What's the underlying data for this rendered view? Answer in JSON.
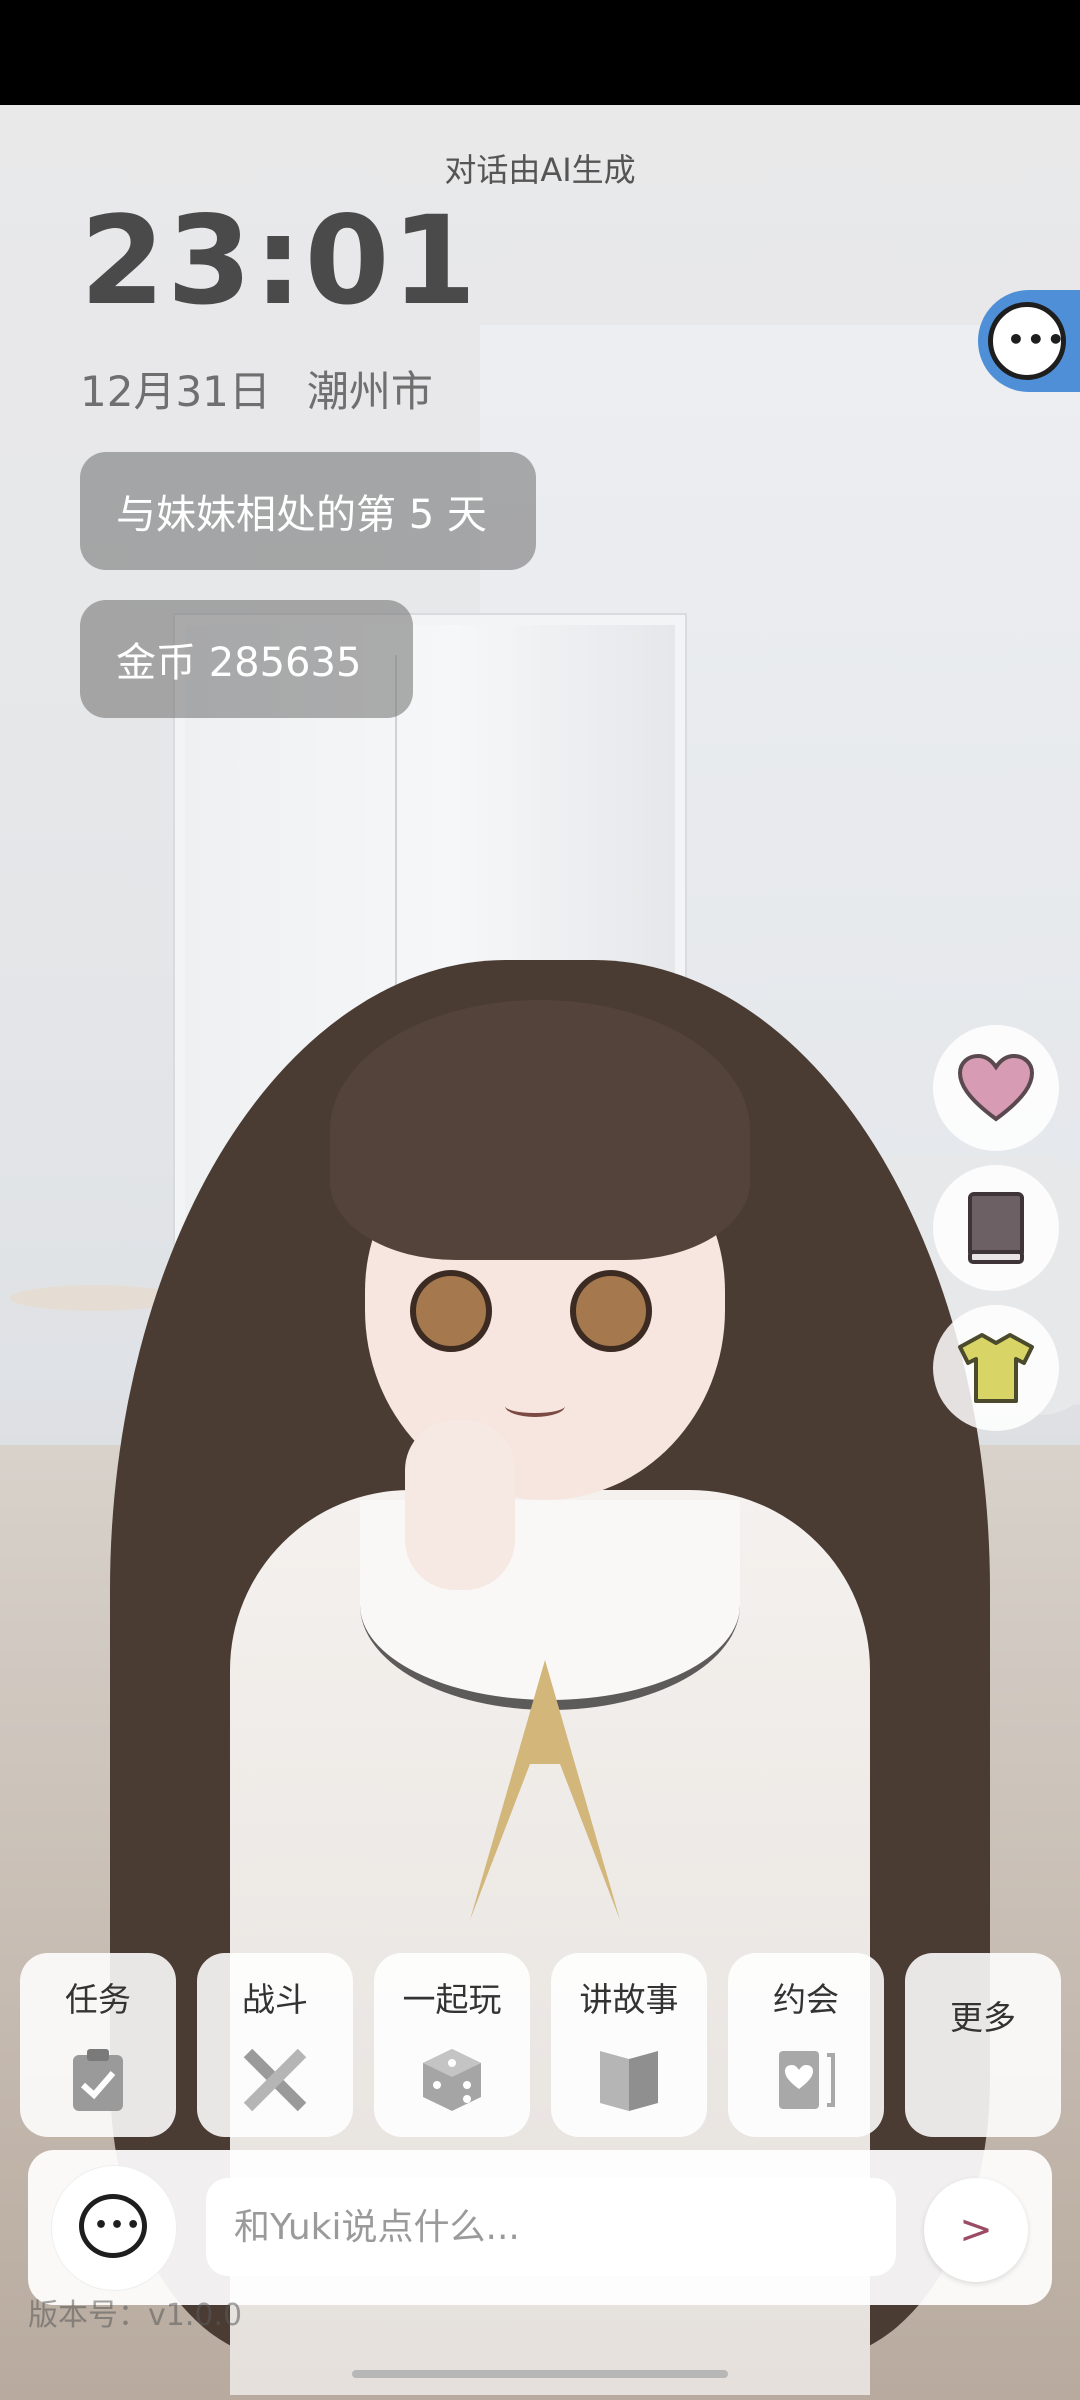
{
  "header": {
    "ai_notice": "对话由AI生成",
    "time": "23:01",
    "date": "12月31日",
    "city": "潮州市"
  },
  "stats": {
    "days_label": "与妹妹相处的第 5 天",
    "coins_label": "金币 285635"
  },
  "side_buttons": [
    {
      "name": "heart-icon",
      "color": "#d79bb3"
    },
    {
      "name": "book-icon",
      "color": "#6c6064"
    },
    {
      "name": "shirt-icon",
      "color": "#d8d566"
    }
  ],
  "actions": [
    {
      "label": "任务",
      "icon": "clipboard-check-icon"
    },
    {
      "label": "战斗",
      "icon": "crossed-swords-icon"
    },
    {
      "label": "一起玩",
      "icon": "dice-icon"
    },
    {
      "label": "讲故事",
      "icon": "open-book-icon"
    },
    {
      "label": "约会",
      "icon": "heart-card-icon"
    },
    {
      "label": "更多",
      "icon": ""
    }
  ],
  "chat": {
    "placeholder": "和Yuki说点什么...",
    "send_label": ">"
  },
  "footer": {
    "version": "版本号：v1.0.0"
  },
  "colors": {
    "accent_blue": "#4f8fd8",
    "send_arrow": "#9b4b64"
  }
}
